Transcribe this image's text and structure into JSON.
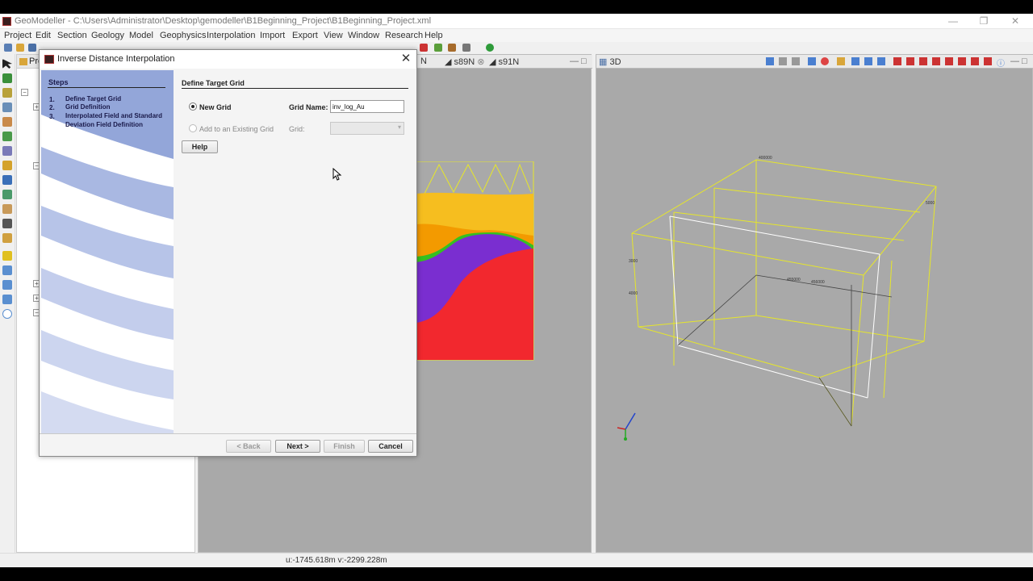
{
  "window": {
    "title": "GeoModeller - C:\\Users\\Administrator\\Desktop\\gemodeller\\B1Beginning_Project\\B1Beginning_Project.xml"
  },
  "menu": [
    "Project",
    "Edit",
    "Section",
    "Geology",
    "Model",
    "Geophysics",
    "Interpolation",
    "Import",
    "Export",
    "View",
    "Window",
    "Research",
    "Help"
  ],
  "project_panel": {
    "tab_label": "Pro"
  },
  "section_tabs": [
    "N",
    "s89N",
    "s91N"
  ],
  "view3d": {
    "tab_label": "3D",
    "axis_labels": [
      "400000",
      "3000",
      "4000",
      "5000",
      "455000",
      "456000"
    ]
  },
  "status": {
    "coords": "u:-1745.618m v:-2299.228m"
  },
  "dialog": {
    "title": "Inverse Distance Interpolation",
    "steps_heading": "Steps",
    "steps": [
      {
        "num": "1.",
        "label": "Define Target Grid"
      },
      {
        "num": "2.",
        "label": "Grid Definition"
      },
      {
        "num": "3.",
        "label": "Interpolated Field and Standard Deviation Field Definition"
      }
    ],
    "content_heading": "Define Target Grid",
    "new_grid_label": "New Grid",
    "new_grid_selected": true,
    "grid_name_label": "Grid Name:",
    "grid_name_value": "inv_log_Au",
    "add_existing_label": "Add to an Existing Grid",
    "grid_label": "Grid:",
    "grid_value": "",
    "help_button": "Help",
    "back_button": "< Back",
    "next_button": "Next >",
    "finish_button": "Finish",
    "cancel_button": "Cancel"
  },
  "colors": {
    "dialog_accent": "#93a6d9",
    "layer_yellow": "#f6be1f",
    "layer_orange": "#f39a00",
    "layer_purple": "#7a2ed0",
    "layer_red": "#f2282e",
    "layer_green": "#36c020",
    "frame_yellow": "#e6e62a"
  }
}
